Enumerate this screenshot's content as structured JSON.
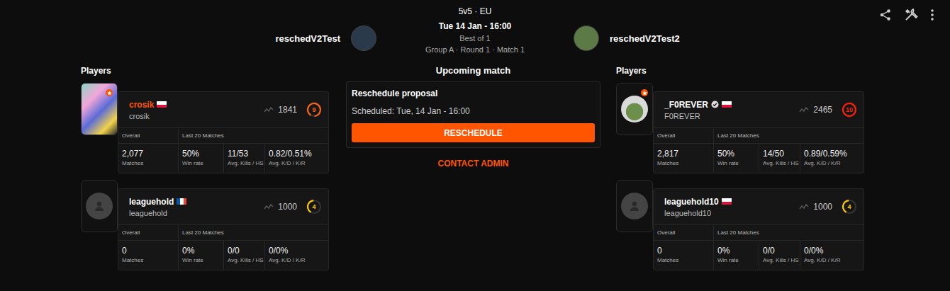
{
  "header": {
    "format": "5v5 · EU",
    "datetime": "Tue 14 Jan - 16:00",
    "best_of": "Best of 1",
    "stage": "Group A · Round 1 · Match 1"
  },
  "teams": [
    {
      "name": "reschedV2Test",
      "avatar_color": "#2b3a4a"
    },
    {
      "name": "reschedV2Test2",
      "avatar_color": "#5c7a45"
    }
  ],
  "players_label": "Players",
  "stat_headers": {
    "overall": "Overall",
    "recent": "Last 20 Matches"
  },
  "stat_labels": [
    "Matches",
    "Win rate",
    "Avg. Kills / HS",
    "Avg. K/D / K/R"
  ],
  "rosters": [
    [
      {
        "name": "crosik",
        "nickname": "crosik",
        "flag": "pl",
        "highlighted": true,
        "verified": false,
        "premium": true,
        "avatar": "photo-square",
        "elo": "1841",
        "skill": "9",
        "level": 0.9,
        "color": "#ff6309",
        "stats": [
          "2,077",
          "50%",
          "11/53",
          "0.82/0.51%"
        ]
      },
      {
        "name": "leaguehold",
        "nickname": "leaguehold",
        "flag": "fr",
        "highlighted": false,
        "verified": false,
        "premium": false,
        "avatar": "placeholder",
        "elo": "1000",
        "skill": "4",
        "level": 0.4,
        "color": "#ffc800",
        "stats": [
          "0",
          "0%",
          "0/0",
          "0/0%"
        ]
      }
    ],
    [
      {
        "name": "_F0REVER",
        "nickname": "F0REVER",
        "flag": "pl",
        "highlighted": false,
        "verified": true,
        "premium": true,
        "avatar": "photo-round",
        "elo": "2465",
        "skill": "10",
        "level": 1.0,
        "color": "#fe1f00",
        "stats": [
          "2,817",
          "50%",
          "14/50",
          "0.89/0.59%"
        ]
      },
      {
        "name": "leaguehold10",
        "nickname": "leaguehold10",
        "flag": "pl",
        "highlighted": false,
        "verified": false,
        "premium": false,
        "avatar": "placeholder",
        "elo": "1000",
        "skill": "4",
        "level": 0.4,
        "color": "#ffc800",
        "stats": [
          "0",
          "0%",
          "0/0",
          "0/0%"
        ]
      }
    ]
  ],
  "center": {
    "title": "Upcoming match",
    "card_title": "Reschedule proposal",
    "scheduled": "Scheduled: Tue, 14 Jan - 16:00",
    "button": "RESCHEDULE",
    "contact": "CONTACT ADMIN"
  }
}
